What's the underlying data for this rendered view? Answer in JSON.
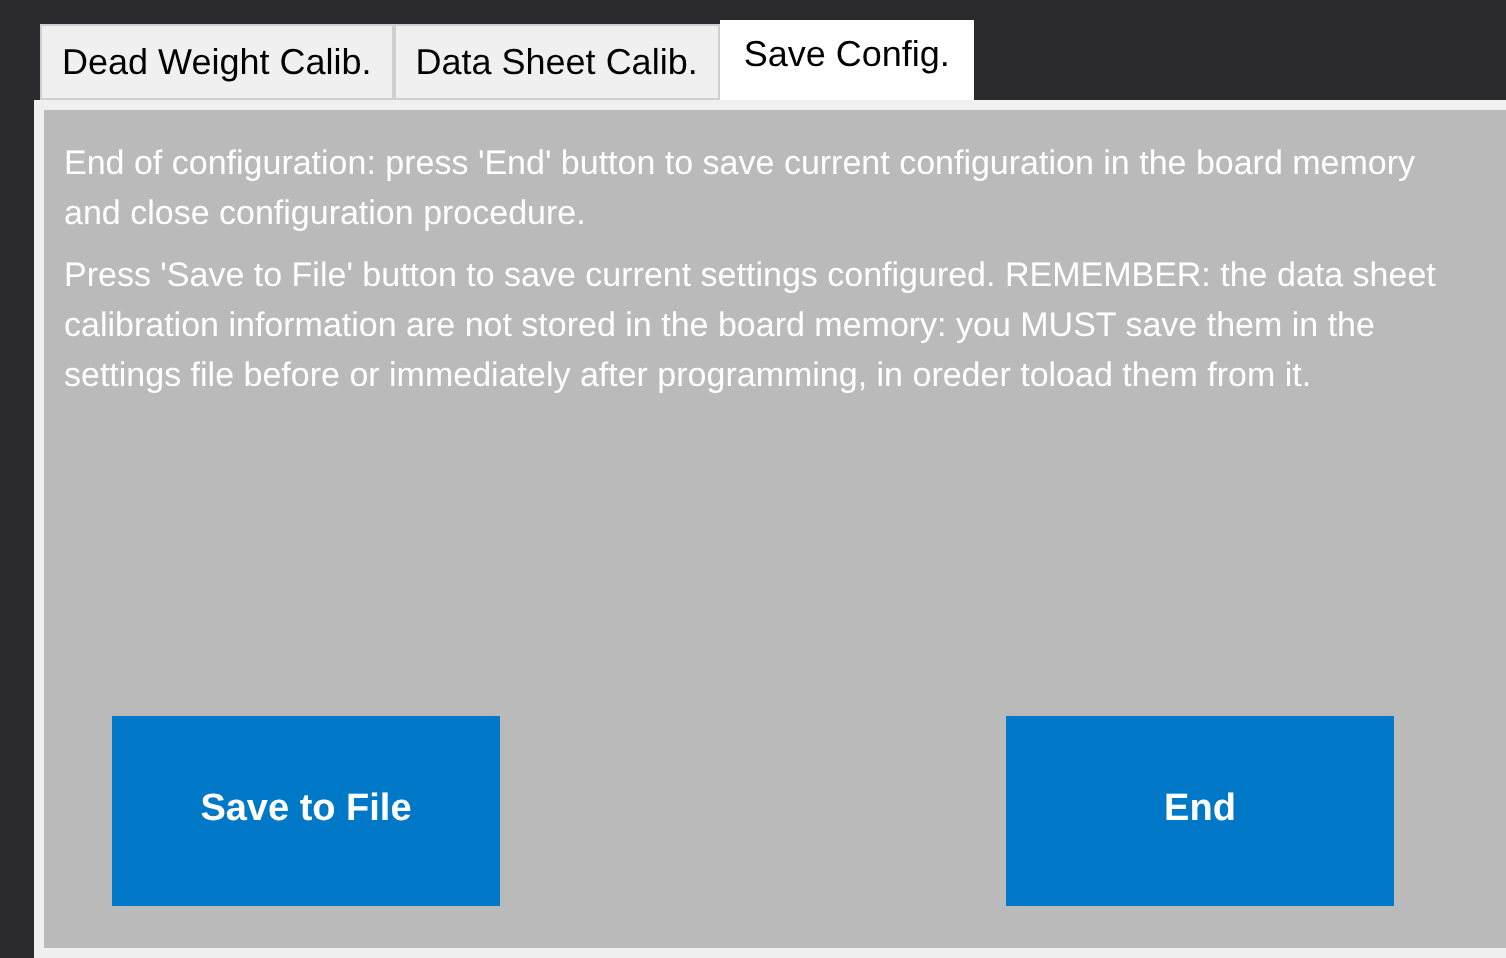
{
  "tabs": [
    {
      "label": "Dead Weight Calib.",
      "selected": false
    },
    {
      "label": "Data Sheet Calib.",
      "selected": false
    },
    {
      "label": "Save Config.",
      "selected": true
    }
  ],
  "panel": {
    "paragraphs": [
      "End of configuration: press 'End' button to save current configuration in the board memory and close configuration procedure.",
      "Press 'Save to File' button to save current settings configured. REMEMBER: the data sheet calibration information are not stored in the board memory: you MUST save them in the settings file before or immediately after programming, in oreder toload them from it."
    ],
    "buttons": [
      "Save to File",
      "End"
    ]
  }
}
